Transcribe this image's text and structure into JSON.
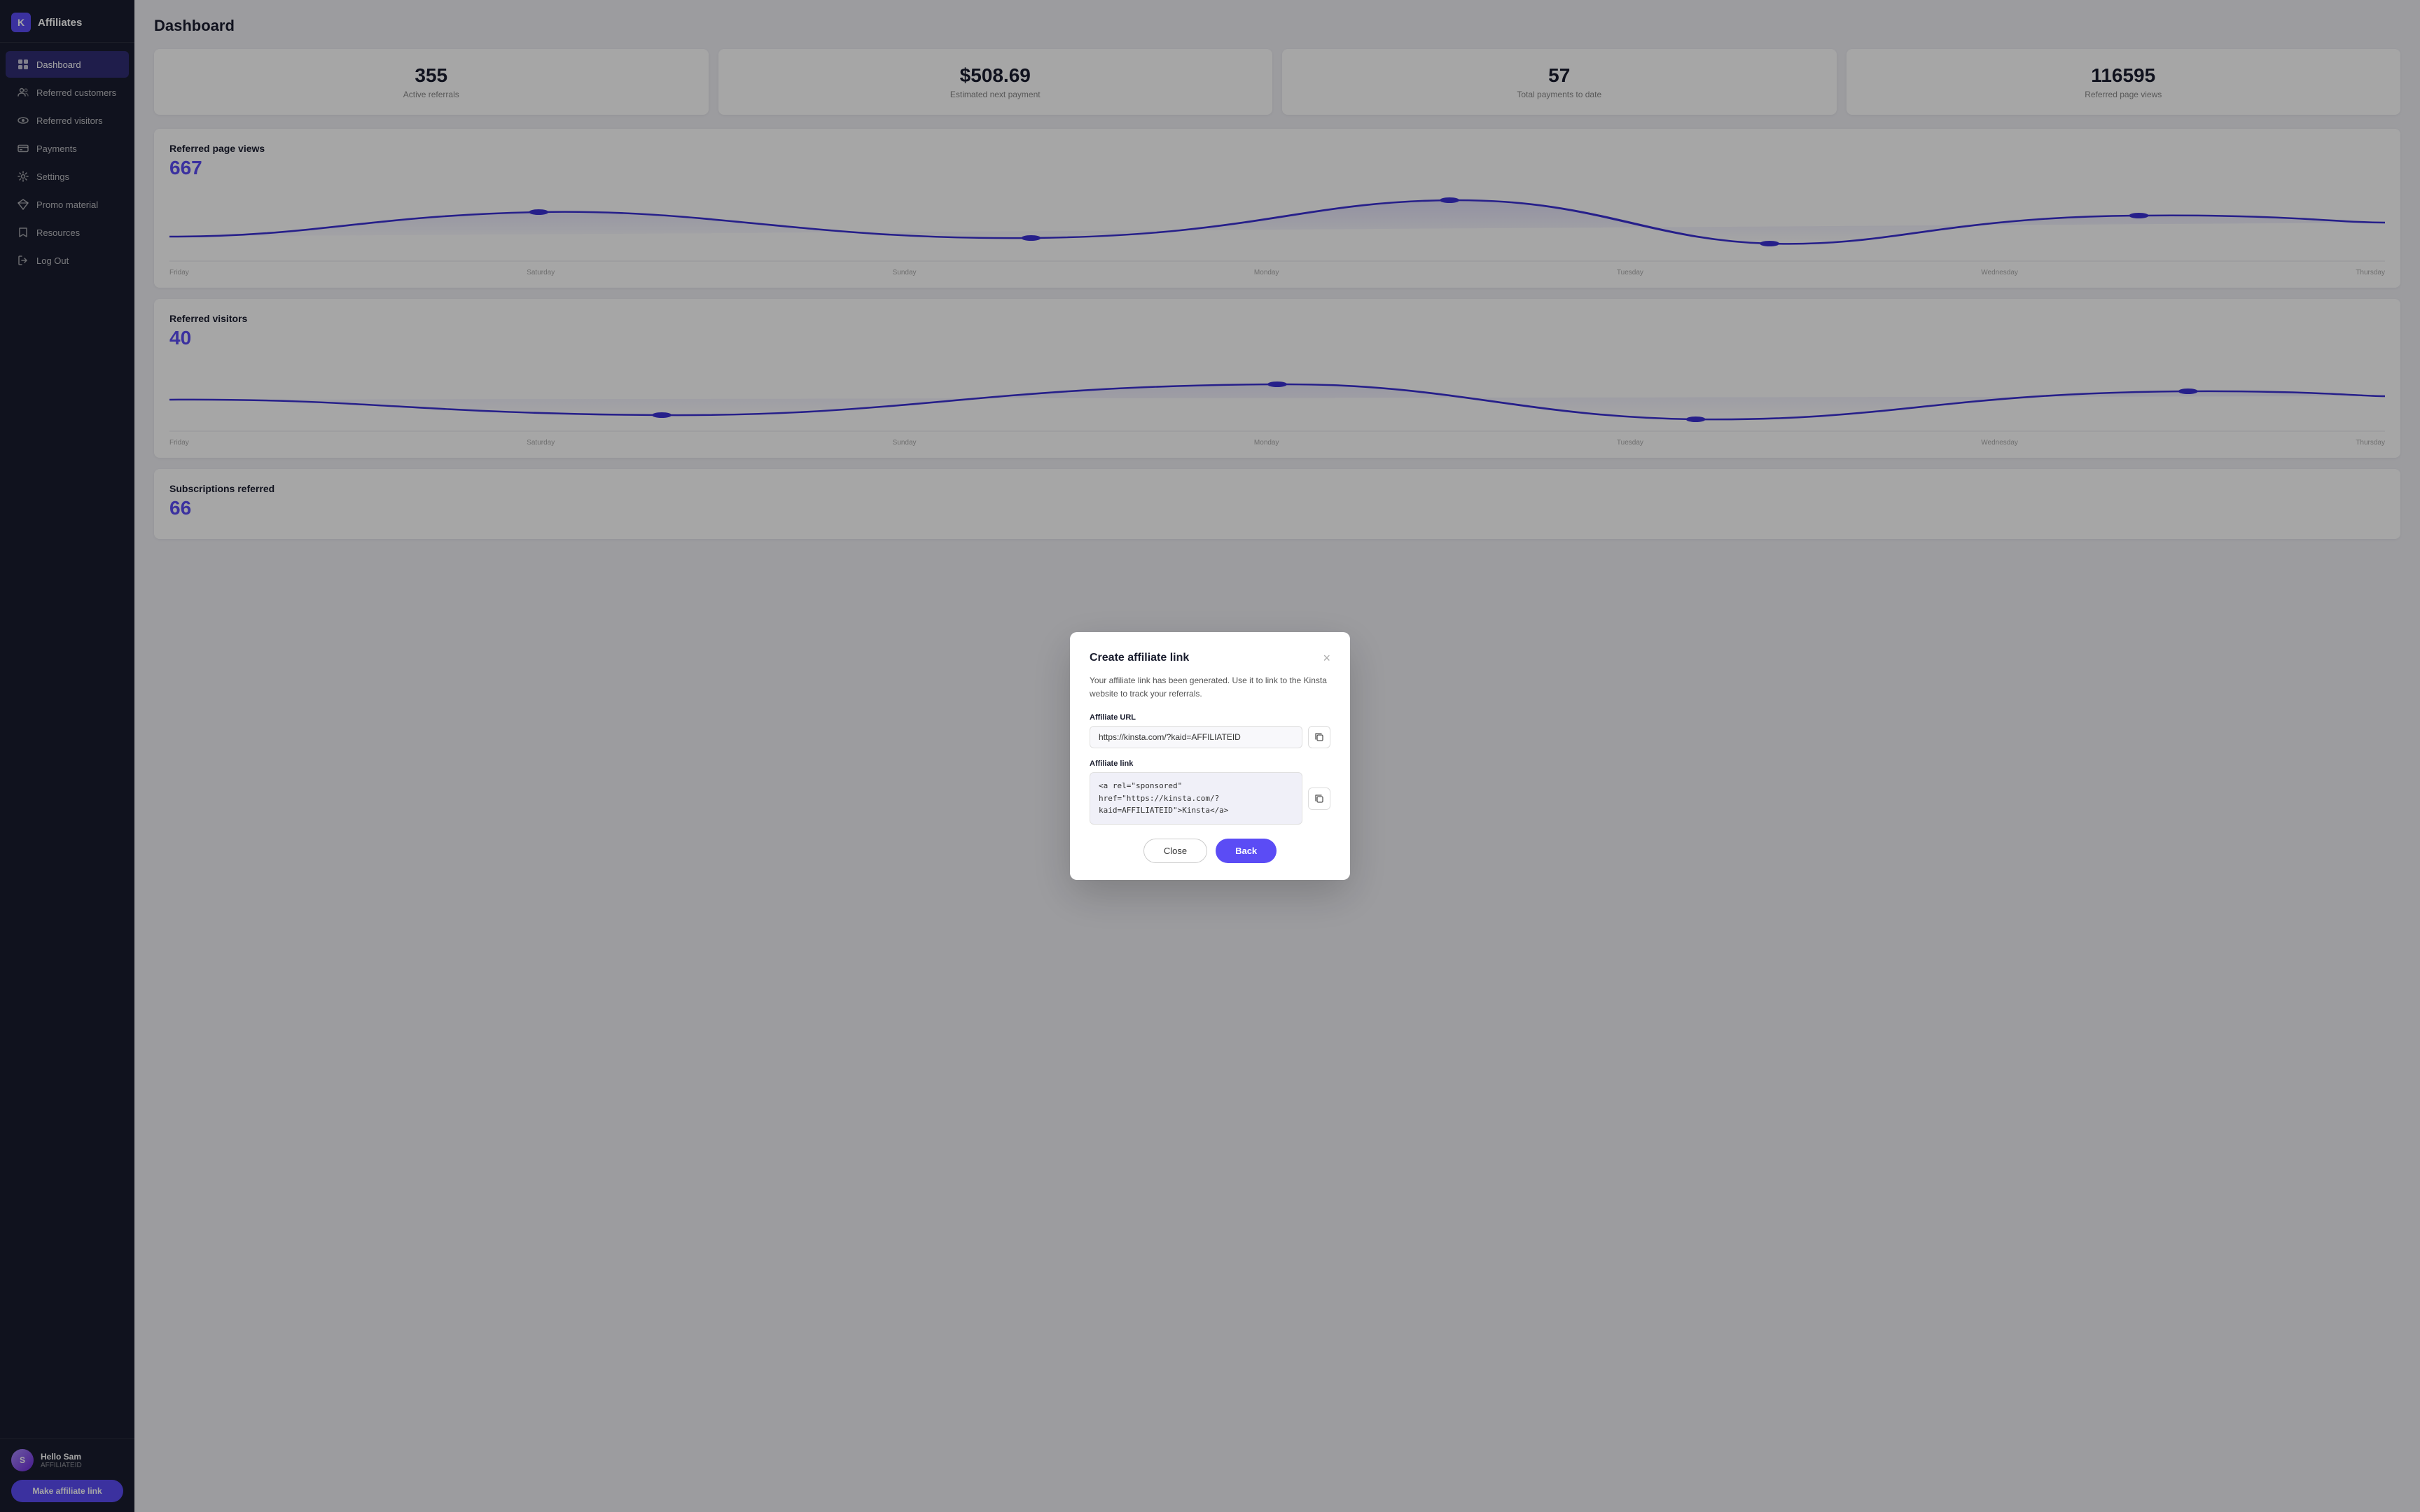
{
  "sidebar": {
    "logo_text": "K",
    "title": "Affiliates",
    "nav_items": [
      {
        "id": "dashboard",
        "label": "Dashboard",
        "icon": "grid",
        "active": true
      },
      {
        "id": "referred-customers",
        "label": "Referred customers",
        "icon": "users"
      },
      {
        "id": "referred-visitors",
        "label": "Referred visitors",
        "icon": "eye"
      },
      {
        "id": "payments",
        "label": "Payments",
        "icon": "credit-card"
      },
      {
        "id": "settings",
        "label": "Settings",
        "icon": "settings"
      },
      {
        "id": "promo-material",
        "label": "Promo material",
        "icon": "diamond"
      },
      {
        "id": "resources",
        "label": "Resources",
        "icon": "bookmark"
      },
      {
        "id": "logout",
        "label": "Log Out",
        "icon": "logout"
      }
    ],
    "user": {
      "name": "Hello Sam",
      "id": "AFFILIATEID",
      "initials": "S"
    },
    "make_link_btn": "Make affiliate link"
  },
  "page": {
    "title": "Dashboard"
  },
  "stats": [
    {
      "value": "355",
      "label": "Active referrals"
    },
    {
      "value": "$508.69",
      "label": "Estimated next payment"
    },
    {
      "value": "57",
      "label": "Total payments to date"
    },
    {
      "value": "116595",
      "label": "Referred page views"
    }
  ],
  "charts": [
    {
      "id": "page-views",
      "title": "Referred page views",
      "number": "667",
      "labels": [
        "Friday",
        "Saturday",
        "Sunday",
        "Monday",
        "Tuesday",
        "Wednesday",
        "Thursday"
      ]
    },
    {
      "id": "visitors",
      "title": "Referred visitors",
      "number": "40",
      "labels": [
        "Friday",
        "Saturday",
        "Sunday",
        "Monday",
        "Tuesday",
        "Wednesday",
        "Thursday"
      ]
    },
    {
      "id": "subscriptions",
      "title": "Subscriptions referred",
      "number": "66",
      "labels": []
    }
  ],
  "modal": {
    "title": "Create affiliate link",
    "description": "Your affiliate link has been generated. Use it to link to the Kinsta website to track your referrals.",
    "url_label": "Affiliate URL",
    "url_value": "https://kinsta.com/?kaid=AFFILIATEID",
    "link_label": "Affiliate link",
    "link_value": "<a rel=\"sponsored\"\nhref=\"https://kinsta.com/?\nkaid=AFFILIATEID\">Kinsta</a>",
    "close_btn": "Close",
    "back_btn": "Back"
  }
}
